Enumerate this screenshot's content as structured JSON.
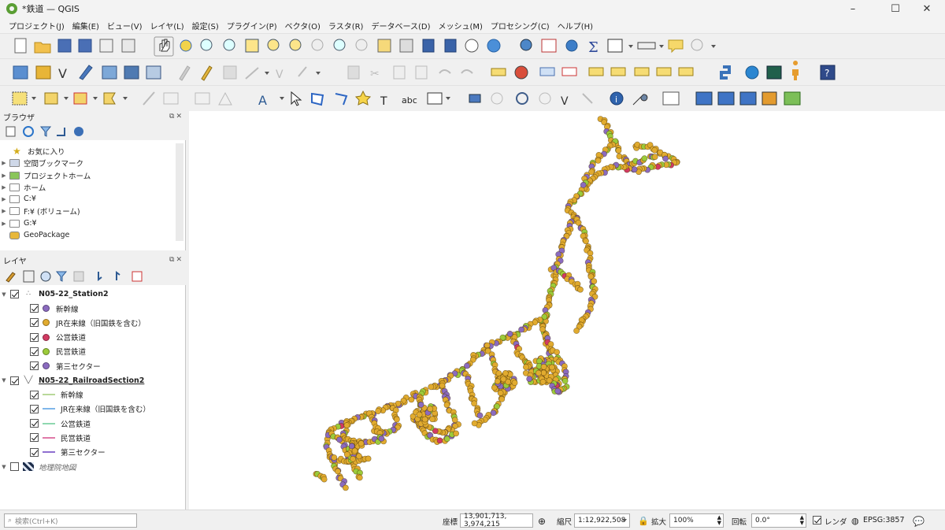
{
  "window": {
    "title": "*鉄道 — QGIS",
    "min_label": "–",
    "max_label": "☐",
    "close_label": "✕"
  },
  "menu": [
    "プロジェクト(J)",
    "編集(E)",
    "ビュー(V)",
    "レイヤ(L)",
    "設定(S)",
    "プラグイン(P)",
    "ベクタ(O)",
    "ラスタ(R)",
    "データベース(D)",
    "メッシュ(M)",
    "プロセシング(C)",
    "ヘルプ(H)"
  ],
  "browser_panel": {
    "title": "ブラウザ",
    "float_dock_icons": "⧉✕",
    "items": [
      {
        "label": "お気に入り",
        "icon": "star-icon"
      },
      {
        "label": "空間ブックマーク",
        "icon": "bookmark-icon"
      },
      {
        "label": "プロジェクトホーム",
        "icon": "project-home-icon"
      },
      {
        "label": "ホーム",
        "icon": "home-icon"
      },
      {
        "label": "C:¥",
        "icon": "drive-icon"
      },
      {
        "label": "F:¥ (ボリューム)",
        "icon": "drive-icon"
      },
      {
        "label": "G:¥",
        "icon": "drive-icon"
      },
      {
        "label": "GeoPackage",
        "icon": "geopackage-icon"
      }
    ]
  },
  "layers_panel": {
    "title": "レイヤ",
    "float_dock_icons": "⧉✕",
    "layers": [
      {
        "name": "N05-22_Station2",
        "checked": true,
        "icon": "point-layer-icon",
        "classes": [
          {
            "label": "新幹線",
            "color": "#8b6bbf"
          },
          {
            "label": "JR在来線（旧国鉄を含む）",
            "color": "#e1ab2f"
          },
          {
            "label": "公営鉄道",
            "color": "#d23a62"
          },
          {
            "label": "民営鉄道",
            "color": "#9ccb3a"
          },
          {
            "label": "第三セクター",
            "color": "#8b6bbf"
          }
        ]
      },
      {
        "name": "N05-22_RailroadSection2",
        "checked": true,
        "icon": "line-layer-icon",
        "classes": [
          {
            "label": "新幹線",
            "color": "#b9d99a"
          },
          {
            "label": "JR在来線（旧国鉄を含む）",
            "color": "#7fb6ea"
          },
          {
            "label": "公営鉄道",
            "color": "#8fd8b0"
          },
          {
            "label": "民営鉄道",
            "color": "#e07aa8"
          },
          {
            "label": "第三セクター",
            "color": "#8f6fd0"
          }
        ]
      },
      {
        "name": "地理院地図",
        "checked": false,
        "icon": "raster-layer-icon",
        "classes": []
      }
    ]
  },
  "statusbar": {
    "search_placeholder": "検索(Ctrl+K)",
    "coordinate_label": "座標",
    "coordinate_value": "13,901,713, 3,974,215",
    "scale_label": "縮尺",
    "scale_value": "1:12,922,508",
    "magnifier_label": "拡大",
    "magnifier_value": "100%",
    "rotation_label": "回転",
    "rotation_value": "0.0°",
    "render_label": "レンダ",
    "render_checked": true,
    "crs_label": "EPSG:3857"
  },
  "map_colors": {
    "jr": "#e1ab2f",
    "shinkansen": "#8b6bbf",
    "private": "#9ccb3a",
    "public": "#d23a62"
  }
}
